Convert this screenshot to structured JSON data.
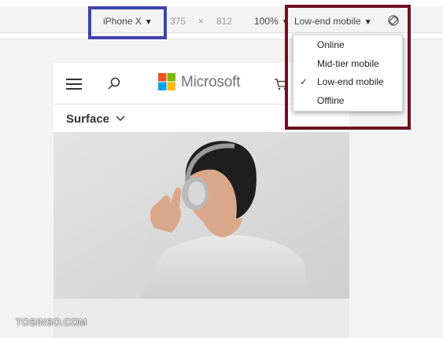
{
  "toolbar": {
    "device": "iPhone X",
    "width": "375",
    "times": "×",
    "height": "812",
    "zoom": "100%",
    "network": "Low-end mobile"
  },
  "network_menu": {
    "items": [
      {
        "label": "Online",
        "checked": false
      },
      {
        "label": "Mid-tier mobile",
        "checked": false
      },
      {
        "label": "Low-end mobile",
        "checked": true
      },
      {
        "label": "Offline",
        "checked": false
      }
    ],
    "check_glyph": "✓"
  },
  "site": {
    "logo_text": "Microsoft",
    "nav_label": "Surface"
  },
  "watermark": "TOSINSO.COM",
  "colors": {
    "device_highlight": "#3e43ad",
    "network_highlight": "#6e1121",
    "logo_red": "#f25022",
    "logo_green": "#7fba00",
    "logo_blue": "#00a4ef",
    "logo_yellow": "#ffb900"
  },
  "icons": [
    "caret-down-icon",
    "rotate-icon",
    "hamburger-icon",
    "search-icon",
    "cart-icon",
    "chevron-down-icon",
    "checkmark-icon"
  ]
}
